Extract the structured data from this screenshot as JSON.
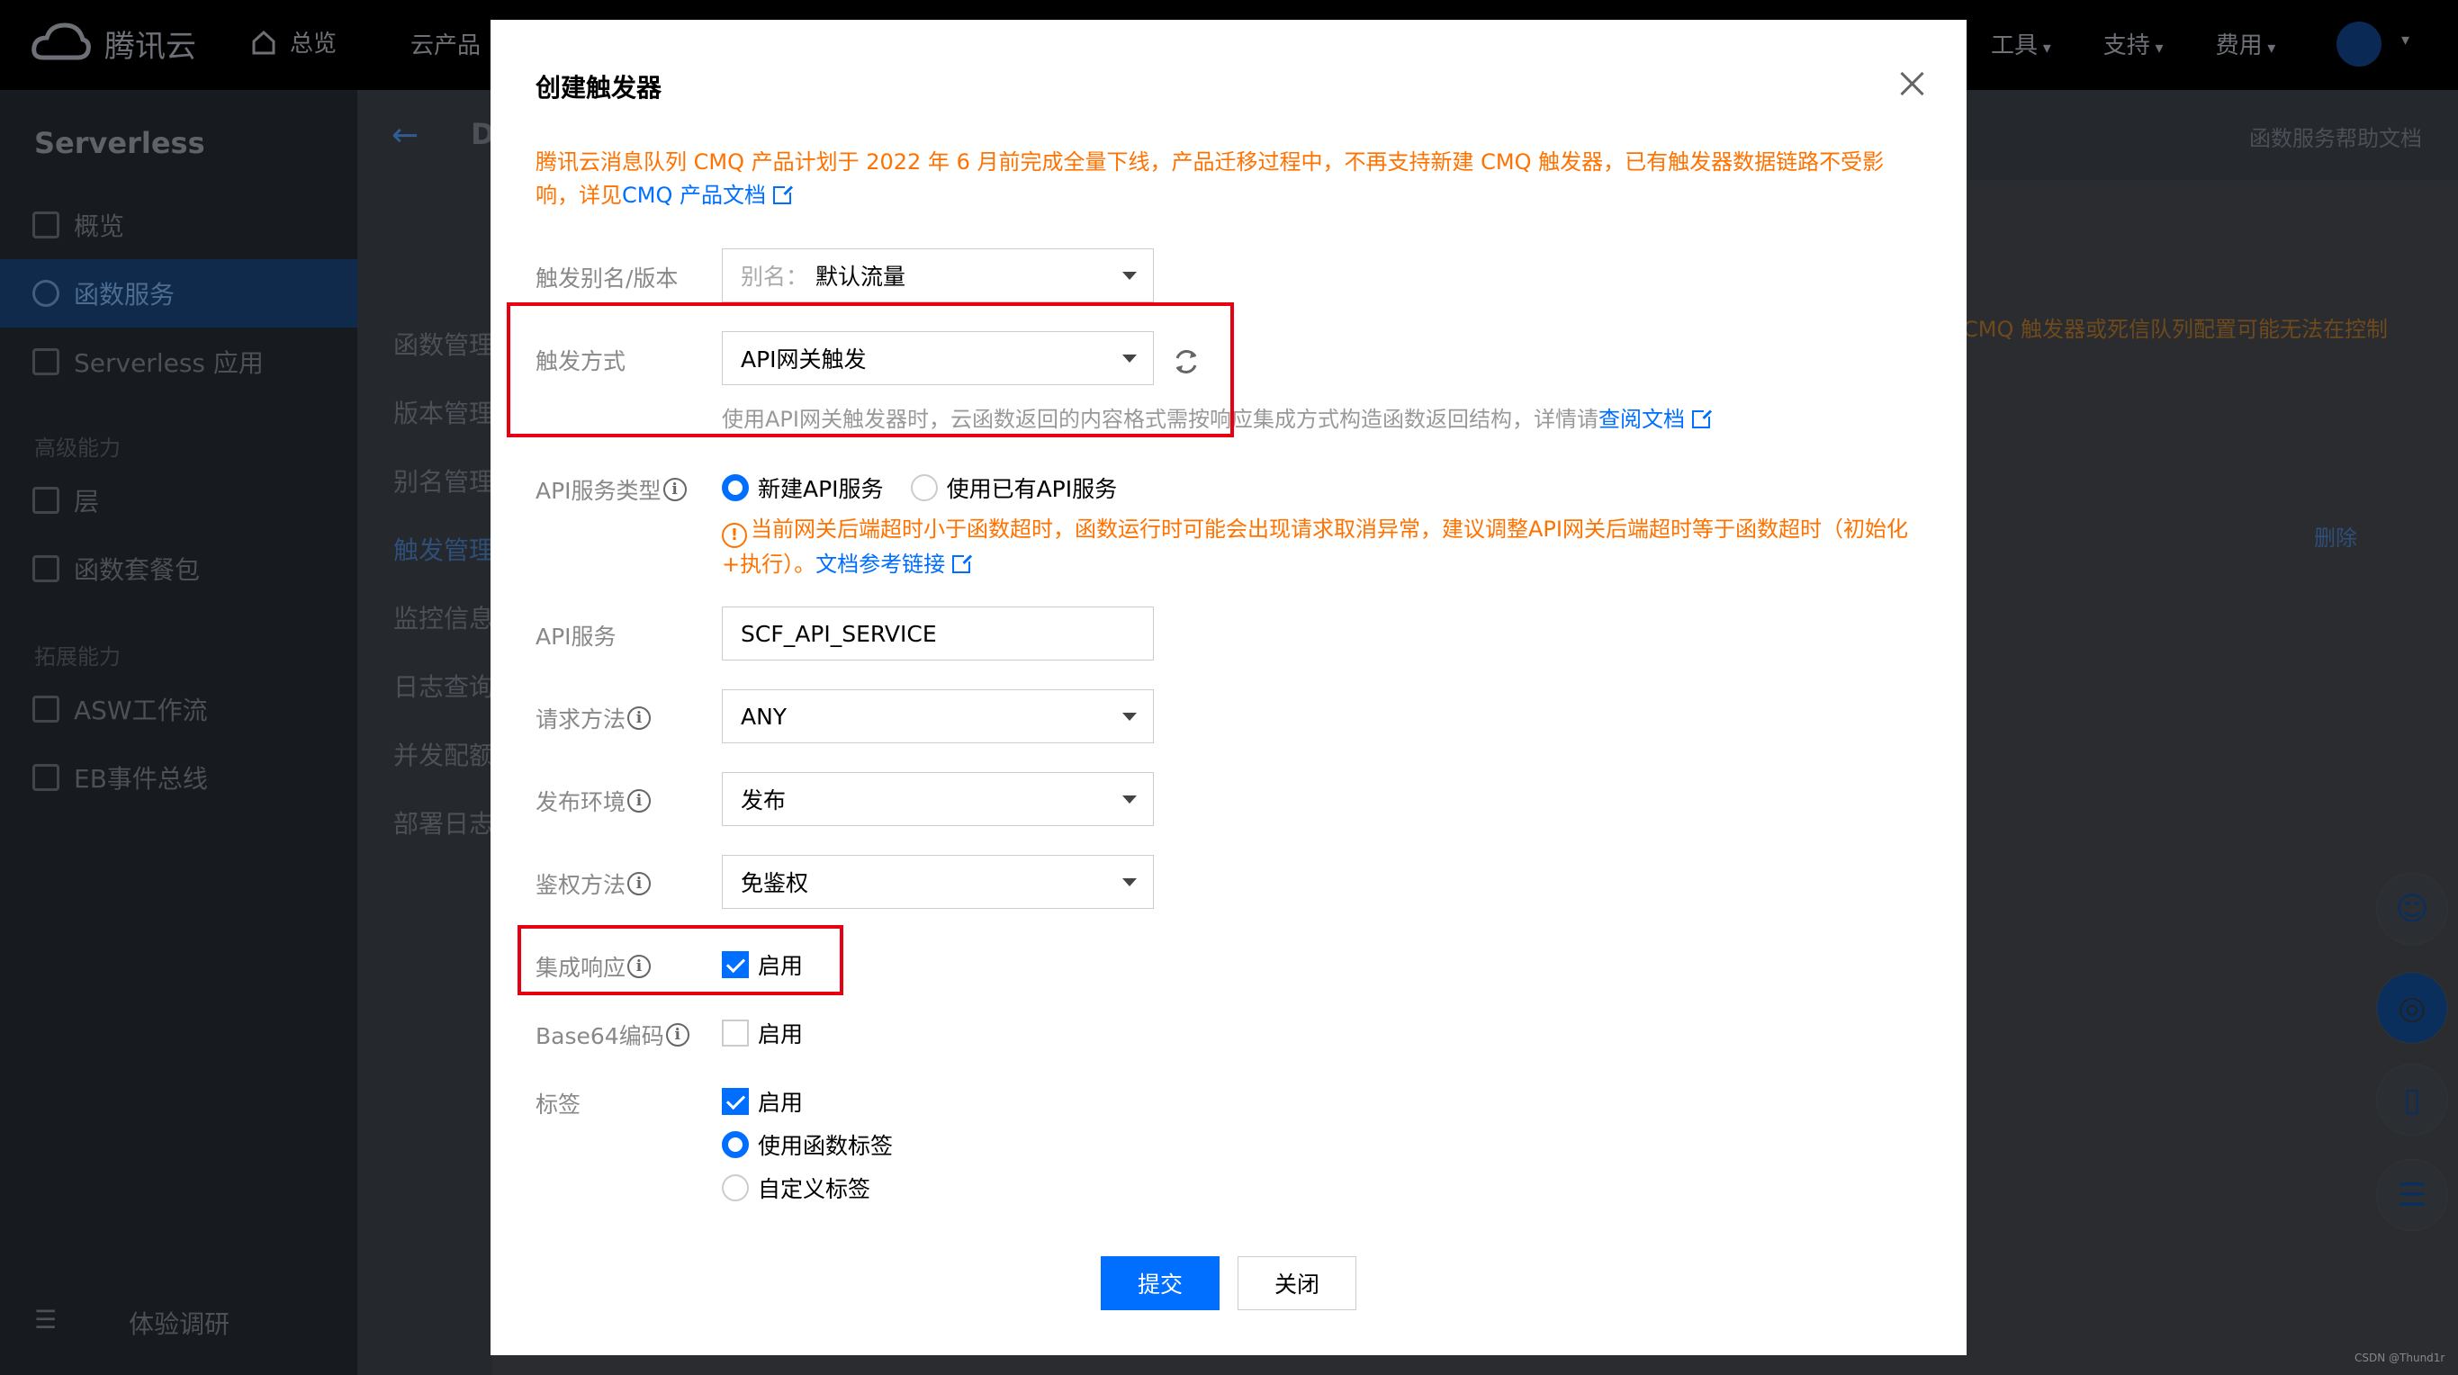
{
  "topbar": {
    "brand": "腾讯云",
    "home": "总览",
    "products": "云产品",
    "menu": [
      "工具",
      "支持",
      "费用"
    ]
  },
  "sidebar": {
    "title": "Serverless",
    "items": [
      {
        "label": "概览"
      },
      {
        "label": "函数服务"
      },
      {
        "label": "Serverless 应用"
      },
      {
        "label": "层"
      },
      {
        "label": "函数套餐包"
      },
      {
        "label": "ASW工作流"
      },
      {
        "label": "EB事件总线"
      }
    ],
    "section_advanced": "高级能力",
    "section_extend": "拓展能力",
    "feedback": "体验调研"
  },
  "content": {
    "header_initial": "D",
    "help": "函数服务帮助文档",
    "subnav": [
      "函数管理",
      "版本管理",
      "别名管理",
      "触发管理",
      "监控信息",
      "日志查询",
      "并发配额",
      "部署日志"
    ],
    "bg_warning": "CMQ 触发器或死信队列配置可能无法在控制",
    "bg_delete": "删除"
  },
  "modal": {
    "title": "创建触发器",
    "notice_text": "腾讯云消息队列 CMQ 产品计划于 2022 年 6 月前完成全量下线，产品迁移过程中，不再支持新建 CMQ 触发器，已有触发器数据链路不受影响，详见",
    "notice_link": "CMQ 产品文档",
    "alias_label": "触发别名/版本",
    "alias_prefix": "别名：",
    "alias_value": "默认流量",
    "trigger_label": "触发方式",
    "trigger_value": "API网关触发",
    "trigger_hint": "使用API网关触发器时，云函数返回的内容格式需按响应集成方式构造函数返回结构，详情请",
    "trigger_hint_link": "查阅文档",
    "service_type_label": "API服务类型",
    "service_type_options": [
      "新建API服务",
      "使用已有API服务"
    ],
    "warning_text": "当前网关后端超时小于函数超时，函数运行时可能会出现请求取消异常，建议调整API网关后端超时等于函数超时（初始化+执行）。",
    "warning_link": "文档参考链接",
    "api_service_label": "API服务",
    "api_service_value": "SCF_API_SERVICE",
    "method_label": "请求方法",
    "method_value": "ANY",
    "env_label": "发布环境",
    "env_value": "发布",
    "auth_label": "鉴权方法",
    "auth_value": "免鉴权",
    "integration_label": "集成响应",
    "integration_check": "启用",
    "base64_label": "Base64编码",
    "base64_check": "启用",
    "tags_label": "标签",
    "tags_check": "启用",
    "tags_options": [
      "使用函数标签",
      "自定义标签"
    ],
    "submit": "提交",
    "close": "关闭"
  },
  "watermark": "CSDN @Thund1r"
}
